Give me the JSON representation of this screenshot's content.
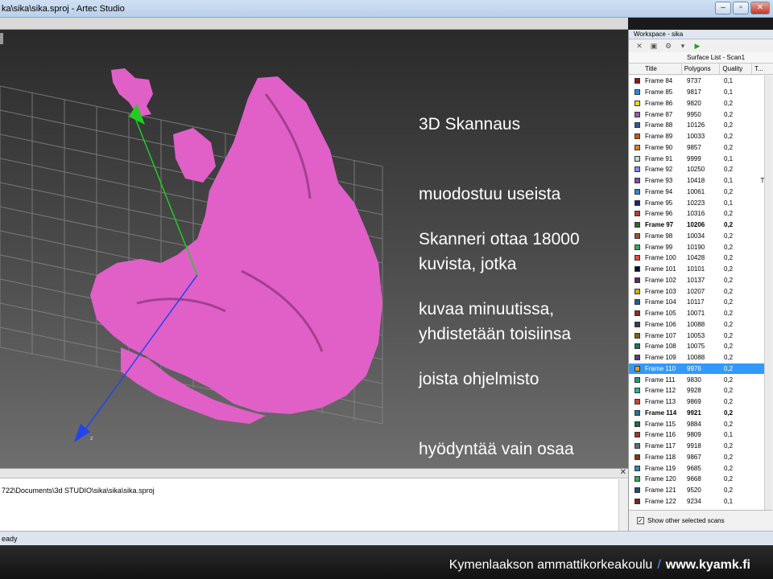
{
  "window": {
    "title": "ka\\sika\\sika.sproj - Artec Studio"
  },
  "slide_text": {
    "block1": [
      "3D Skannaus",
      "muodostuu useista",
      "kuvista, jotka",
      "yhdistetään toisiinsa"
    ],
    "block2": [
      "Skanneri ottaa 18000",
      "kuvaa minuutissa,",
      "joista ohjelmisto",
      "hyödyntää vain osaa"
    ]
  },
  "viewport": {
    "axis_label_z": "z",
    "mesh_color": "#e060c8"
  },
  "console": {
    "path": "722\\Documents\\3d STUDIO\\sika\\sika\\sika.sproj"
  },
  "status": {
    "text": "eady"
  },
  "panel": {
    "title": "Workspace - sika",
    "subtitle": "Surface List - Scan1",
    "columns": {
      "title": "Title",
      "polygons": "Polygons",
      "quality": "Quality",
      "t": "T..."
    },
    "rows": [
      {
        "title": "Frame 84",
        "poly": "9737",
        "qual": "0,1",
        "t": "",
        "color": "#8b1a1a"
      },
      {
        "title": "Frame 85",
        "poly": "9817",
        "qual": "0,1",
        "t": "",
        "color": "#1e90ff"
      },
      {
        "title": "Frame 86",
        "poly": "9820",
        "qual": "0,2",
        "t": "",
        "color": "#ffd700"
      },
      {
        "title": "Frame 87",
        "poly": "9950",
        "qual": "0,2",
        "t": "",
        "color": "#9b59b6"
      },
      {
        "title": "Frame 88",
        "poly": "10126",
        "qual": "0,2",
        "t": "",
        "color": "#2c5aa0"
      },
      {
        "title": "Frame 89",
        "poly": "10033",
        "qual": "0,2",
        "t": "",
        "color": "#d35400"
      },
      {
        "title": "Frame 90",
        "poly": "9857",
        "qual": "0,2",
        "t": "",
        "color": "#e67e22"
      },
      {
        "title": "Frame 91",
        "poly": "9999",
        "qual": "0,1",
        "t": "",
        "color": "#b8e0d2"
      },
      {
        "title": "Frame 92",
        "poly": "10250",
        "qual": "0,2",
        "t": "",
        "color": "#7f8cff"
      },
      {
        "title": "Frame 93",
        "poly": "10418",
        "qual": "0,1",
        "t": "T",
        "color": "#8e44ad"
      },
      {
        "title": "Frame 94",
        "poly": "10061",
        "qual": "0,2",
        "t": "",
        "color": "#2e86de"
      },
      {
        "title": "Frame 95",
        "poly": "10223",
        "qual": "0,1",
        "t": "",
        "color": "#1a237e"
      },
      {
        "title": "Frame 96",
        "poly": "10316",
        "qual": "0,2",
        "t": "",
        "color": "#c0392b"
      },
      {
        "title": "Frame 97",
        "poly": "10206",
        "qual": "0,2",
        "t": "",
        "color": "#2d6a2d",
        "bold": true
      },
      {
        "title": "Frame 98",
        "poly": "10034",
        "qual": "0,2",
        "t": "",
        "color": "#a0522d"
      },
      {
        "title": "Frame 99",
        "poly": "10190",
        "qual": "0,2",
        "t": "",
        "color": "#27ae60"
      },
      {
        "title": "Frame 100",
        "poly": "10428",
        "qual": "0,2",
        "t": "",
        "color": "#e74c3c"
      },
      {
        "title": "Frame 101",
        "poly": "10101",
        "qual": "0,2",
        "t": "",
        "color": "#0b0b3b"
      },
      {
        "title": "Frame 102",
        "poly": "10137",
        "qual": "0,2",
        "t": "",
        "color": "#5b2c6f"
      },
      {
        "title": "Frame 103",
        "poly": "10207",
        "qual": "0,2",
        "t": "",
        "color": "#d4ac0d"
      },
      {
        "title": "Frame 104",
        "poly": "10117",
        "qual": "0,2",
        "t": "",
        "color": "#1f618d"
      },
      {
        "title": "Frame 105",
        "poly": "10071",
        "qual": "0,2",
        "t": "",
        "color": "#922b21"
      },
      {
        "title": "Frame 106",
        "poly": "10088",
        "qual": "0,2",
        "t": "",
        "color": "#2e4053"
      },
      {
        "title": "Frame 107",
        "poly": "10053",
        "qual": "0,2",
        "t": "",
        "color": "#7d6608"
      },
      {
        "title": "Frame 108",
        "poly": "10075",
        "qual": "0,2",
        "t": "",
        "color": "#117a65"
      },
      {
        "title": "Frame 109",
        "poly": "10088",
        "qual": "0,2",
        "t": "",
        "color": "#6c3483"
      },
      {
        "title": "Frame 110",
        "poly": "9976",
        "qual": "0,2",
        "t": "",
        "color": "#f39c12",
        "selected": true
      },
      {
        "title": "Frame 111",
        "poly": "9830",
        "qual": "0,2",
        "t": "",
        "color": "#16a085"
      },
      {
        "title": "Frame 112",
        "poly": "9928",
        "qual": "0,2",
        "t": "",
        "color": "#1abc9c"
      },
      {
        "title": "Frame 113",
        "poly": "9869",
        "qual": "0,2",
        "t": "",
        "color": "#cb4335"
      },
      {
        "title": "Frame 114",
        "poly": "9921",
        "qual": "0,2",
        "t": "",
        "color": "#2471a3",
        "bold": true
      },
      {
        "title": "Frame 115",
        "poly": "9884",
        "qual": "0,2",
        "t": "",
        "color": "#196f3d"
      },
      {
        "title": "Frame 116",
        "poly": "9809",
        "qual": "0,1",
        "t": "",
        "color": "#a93226"
      },
      {
        "title": "Frame 117",
        "poly": "9918",
        "qual": "0,2",
        "t": "",
        "color": "#5d6d7e"
      },
      {
        "title": "Frame 118",
        "poly": "9867",
        "qual": "0,2",
        "t": "",
        "color": "#873600"
      },
      {
        "title": "Frame 119",
        "poly": "9685",
        "qual": "0,2",
        "t": "",
        "color": "#2e86c1"
      },
      {
        "title": "Frame 120",
        "poly": "9668",
        "qual": "0,2",
        "t": "",
        "color": "#28b463"
      },
      {
        "title": "Frame 121",
        "poly": "9520",
        "qual": "0,2",
        "t": "",
        "color": "#1b4f72"
      },
      {
        "title": "Frame 122",
        "poly": "9234",
        "qual": "0,1",
        "t": "",
        "color": "#7b241c"
      }
    ],
    "footer_checkbox_label": "Show other selected scans",
    "footer_checked": true
  },
  "footer": {
    "org": "Kymenlaakson ammattikorkeakoulu",
    "separator": "/",
    "site": "www.kyamk.fi"
  },
  "colors": {
    "selection": "#3399ff",
    "accent_blue": "#4a9bff"
  }
}
